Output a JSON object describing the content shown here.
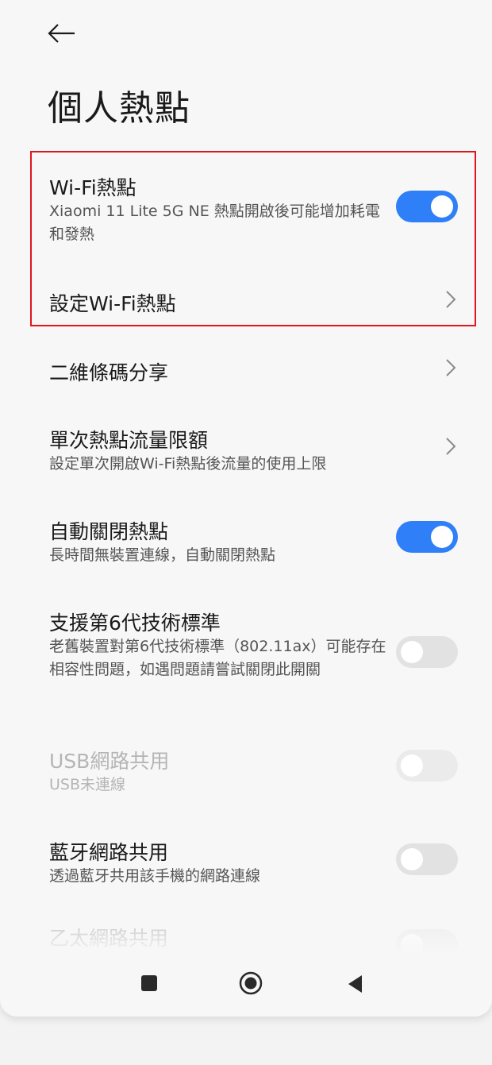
{
  "header": {
    "title": "個人熱點"
  },
  "items": [
    {
      "title": "Wi-Fi熱點",
      "subtitle": "Xiaomi 11 Lite 5G NE 熱點開啟後可能增加耗電和發熱",
      "control": "toggle",
      "state": "on"
    },
    {
      "title": "設定Wi-Fi熱點",
      "control": "chevron"
    },
    {
      "title": "二維條碼分享",
      "control": "chevron"
    },
    {
      "title": "單次熱點流量限額",
      "subtitle": "設定單次開啟Wi-Fi熱點後流量的使用上限",
      "control": "chevron"
    },
    {
      "title": "自動關閉熱點",
      "subtitle": "長時間無裝置連線，自動關閉熱點",
      "control": "toggle",
      "state": "on"
    },
    {
      "title": "支援第6代技術標準",
      "subtitle": "老舊裝置對第6代技術標準（802.11ax）可能存在相容性問題，如遇問題請嘗試關閉此開關",
      "control": "toggle",
      "state": "off"
    },
    {
      "title": "USB網路共用",
      "subtitle": "USB未連線",
      "control": "toggle",
      "state": "off",
      "disabled": true
    },
    {
      "title": "藍牙網路共用",
      "subtitle": "透過藍牙共用該手機的網路連線",
      "control": "toggle",
      "state": "off"
    },
    {
      "title": "乙太網路共用",
      "control": "toggle",
      "state": "off",
      "disabled": true
    }
  ],
  "colors": {
    "accent": "#2f7ff8",
    "highlight_border": "#e0161c",
    "toggle_off": "#e2e2e2"
  },
  "icons": {
    "back": "arrow-left-icon",
    "chevron": "chevron-right-icon",
    "nav_recents": "square-icon",
    "nav_home": "circle-icon",
    "nav_back": "triangle-left-icon"
  }
}
